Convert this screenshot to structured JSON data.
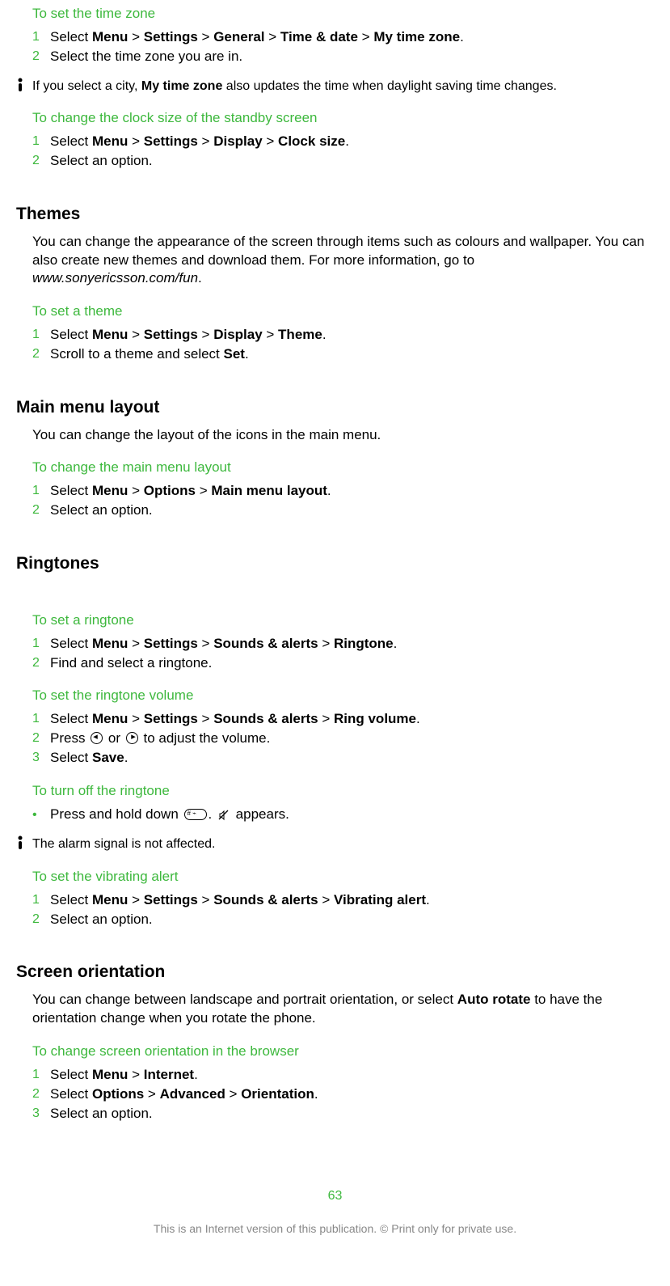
{
  "s1": {
    "heading": "To set the time zone",
    "step1_a": "Select ",
    "step1_b": "Menu",
    "step1_c": " > ",
    "step1_d": "Settings",
    "step1_e": " > ",
    "step1_f": "General",
    "step1_g": " > ",
    "step1_h": "Time & date",
    "step1_i": " > ",
    "step1_j": "My time zone",
    "step1_k": ".",
    "step2": "Select the time zone you are in.",
    "note_a": "If you select a city, ",
    "note_b": "My time zone",
    "note_c": " also updates the time when daylight saving time changes."
  },
  "s2": {
    "heading": "To change the clock size of the standby screen",
    "step1_a": "Select ",
    "step1_b": "Menu",
    "step1_c": " > ",
    "step1_d": "Settings",
    "step1_e": " > ",
    "step1_f": "Display",
    "step1_g": " > ",
    "step1_h": "Clock size",
    "step1_i": ".",
    "step2": "Select an option."
  },
  "themes": {
    "title": "Themes",
    "para_a": "You can change the appearance of the screen through items such as colours and wallpaper. You can also create new themes and download them. For more information, go to ",
    "para_b": "www.sonyericsson.com/fun",
    "para_c": "."
  },
  "s3": {
    "heading": "To set a theme",
    "step1_a": "Select ",
    "step1_b": "Menu",
    "step1_c": " > ",
    "step1_d": "Settings",
    "step1_e": " > ",
    "step1_f": "Display",
    "step1_g": " > ",
    "step1_h": "Theme",
    "step1_i": ".",
    "step2_a": "Scroll to a theme and select ",
    "step2_b": "Set",
    "step2_c": "."
  },
  "mainmenu": {
    "title": "Main menu layout",
    "para": "You can change the layout of the icons in the main menu."
  },
  "s4": {
    "heading": "To change the main menu layout",
    "step1_a": "Select ",
    "step1_b": "Menu",
    "step1_c": " > ",
    "step1_d": "Options",
    "step1_e": " > ",
    "step1_f": "Main menu layout",
    "step1_g": ".",
    "step2": "Select an option."
  },
  "ringtones": {
    "title": "Ringtones"
  },
  "s5": {
    "heading": "To set a ringtone",
    "step1_a": "Select ",
    "step1_b": "Menu",
    "step1_c": " > ",
    "step1_d": "Settings",
    "step1_e": " > ",
    "step1_f": "Sounds & alerts",
    "step1_g": " > ",
    "step1_h": "Ringtone",
    "step1_i": ".",
    "step2": "Find and select a ringtone."
  },
  "s6": {
    "heading": "To set the ringtone volume",
    "step1_a": "Select ",
    "step1_b": "Menu",
    "step1_c": " > ",
    "step1_d": "Settings",
    "step1_e": " > ",
    "step1_f": "Sounds & alerts",
    "step1_g": " > ",
    "step1_h": "Ring volume",
    "step1_i": ".",
    "step2_a": "Press ",
    "step2_b": " or ",
    "step2_c": " to adjust the volume.",
    "step3_a": "Select ",
    "step3_b": "Save",
    "step3_c": "."
  },
  "s7": {
    "heading": "To turn off the ringtone",
    "step_a": "Press and hold down ",
    "step_b": ". ",
    "step_c": " appears.",
    "note": "The alarm signal is not affected."
  },
  "s8": {
    "heading": "To set the vibrating alert",
    "step1_a": "Select ",
    "step1_b": "Menu",
    "step1_c": " > ",
    "step1_d": "Settings",
    "step1_e": " > ",
    "step1_f": "Sounds & alerts",
    "step1_g": " > ",
    "step1_h": "Vibrating alert",
    "step1_i": ".",
    "step2": "Select an option."
  },
  "orientation": {
    "title": "Screen orientation",
    "para_a": "You can change between landscape and portrait orientation, or select ",
    "para_b": "Auto rotate",
    "para_c": " to have the orientation change when you rotate the phone."
  },
  "s9": {
    "heading": "To change screen orientation in the browser",
    "step1_a": "Select ",
    "step1_b": "Menu",
    "step1_c": " > ",
    "step1_d": "Internet",
    "step1_e": ".",
    "step2_a": "Select ",
    "step2_b": "Options",
    "step2_c": " > ",
    "step2_d": "Advanced",
    "step2_e": " > ",
    "step2_f": "Orientation",
    "step2_g": ".",
    "step3": "Select an option."
  },
  "nums": {
    "n1": "1",
    "n2": "2",
    "n3": "3",
    "bullet": "•",
    "bang": "!"
  },
  "page": "63",
  "footer": "This is an Internet version of this publication. © Print only for private use."
}
